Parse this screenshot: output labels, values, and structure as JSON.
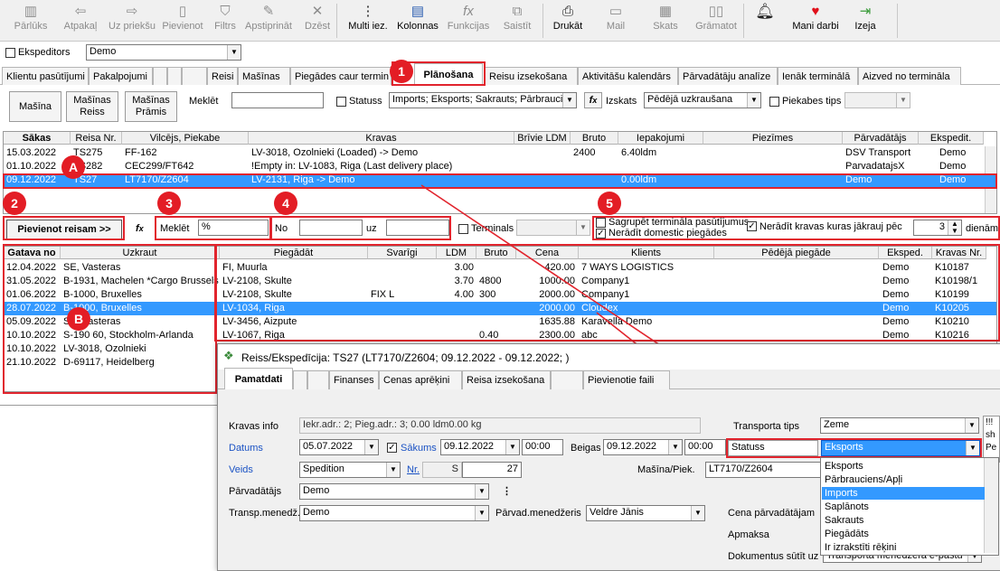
{
  "toolbar": {
    "items": [
      "Pārlūks",
      "Atpakaļ",
      "Uz priekšu",
      "Pievienot",
      "Filtrs",
      "Apstiprināt",
      "Dzēst",
      "Multi iez.",
      "Kolonnas",
      "Funkcijas",
      "Saistīt",
      "Drukāt",
      "Mail",
      "Skats",
      "Grāmatot",
      "",
      "Mani darbi",
      "Izeja"
    ]
  },
  "forwarder": {
    "label": "Ekspeditors",
    "value": "Demo"
  },
  "tabs": [
    "Klientu pasūtījumi",
    "Pakalpojumi",
    "",
    "",
    "",
    "Reisi",
    "Mašīnas",
    "Piegādes caur termin",
    "Plānošana",
    "Reisu izsekošana",
    "Aktivitāšu kalendārs",
    "Pārvadātāju analīze",
    "Ienāk terminālā",
    "Aizved no termināla"
  ],
  "top_controls": {
    "btn_masina": "Mašīna",
    "btn_masinas_reiss": "Mašīnas Reiss",
    "btn_masinas_pramis": "Mašīnas Prāmis",
    "search_label": "Meklēt",
    "status_label": "Statuss",
    "status_value": "Imports; Eksports; Sakrauts; Pārbraucie",
    "izskats_label": "Izskats",
    "izskats_value": "Pēdējā uzkraušana",
    "piekabes_label": "Piekabes tips"
  },
  "trips": {
    "headers": [
      "Sākas",
      "Reisa Nr.",
      "Vilcējs, Piekabe",
      "Kravas",
      "Brīvie LDM",
      "Bruto",
      "Iepakojumi",
      "Piezīmes",
      "Pārvadātājs",
      "Ekspedit."
    ],
    "rows": [
      [
        "15.03.2022",
        "TS275",
        "FF-162",
        "LV-3018, Ozolnieki (Loaded) -> Demo",
        "",
        "2400",
        "6.40ldm",
        "",
        "DSV Transport",
        "Demo"
      ],
      [
        "01.10.2022",
        "TS282",
        "CEC299/FT642",
        "!Empty in: LV-1083, Riga (Last delivery place)",
        "",
        "",
        "",
        "",
        "ParvadatajsX",
        "Demo"
      ],
      [
        "09.12.2022",
        "TS27",
        "LT7170/Z2604",
        "LV-2131, Riga -> Demo",
        "",
        "",
        "0.00ldm",
        "",
        "Demo",
        "Demo"
      ]
    ]
  },
  "mid_controls": {
    "add_btn": "Pievienot reisam >>",
    "search_label": "Meklēt",
    "search_value": "%",
    "no_label": "No",
    "uz_label": "uz",
    "terminals_label": "Terminals",
    "group_label": "Sagrupēt termināla pasūtījumus",
    "domestic_label": "Nerādīt domestic piegādes",
    "hide_label": "Nerādīt kravas kuras jākrauj pēc",
    "days_value": "3",
    "days_label": "dienām"
  },
  "orders": {
    "headers": [
      "Gatava no",
      "Uzkraut",
      "Piegādāt",
      "Svarīgi",
      "LDM",
      "Bruto",
      "Cena",
      "Klients",
      "Pēdējā piegāde",
      "Eksped.",
      "Kravas Nr."
    ],
    "rows": [
      [
        "12.04.2022",
        "SE, Vasteras",
        "FI, Muurla",
        "",
        "3.00",
        "",
        "420.00",
        "7 WAYS LOGISTICS",
        "",
        "Demo",
        "K10187"
      ],
      [
        "31.05.2022",
        "B-1931, Machelen *Cargo Brussels",
        "LV-2108, Skulte",
        "",
        "3.70",
        "4800",
        "1000.00",
        "Company1",
        "",
        "Demo",
        "K10198/1"
      ],
      [
        "01.06.2022",
        "B-1000, Bruxelles",
        "LV-2108, Skulte",
        "FIX L",
        "4.00",
        "300",
        "2000.00",
        "Company1",
        "",
        "Demo",
        "K10199"
      ],
      [
        "28.07.2022",
        "B-1000, Bruxelles",
        "LV-1034, Riga",
        "",
        "",
        "",
        "2000.00",
        "Cloudex",
        "",
        "Demo",
        "K10205"
      ],
      [
        "05.09.2022",
        "SE, Vasteras",
        "LV-3456, Aizpute",
        "",
        "",
        "",
        "1635.88",
        "Karavella Demo",
        "",
        "Demo",
        "K10210"
      ],
      [
        "10.10.2022",
        "S-190 60, Stockholm-Arlanda",
        "LV-1067, Riga",
        "",
        "",
        "0.40",
        "2300.00",
        "abc",
        "",
        "Demo",
        "K10216"
      ],
      [
        "10.10.2022",
        "LV-3018, Ozolnieki",
        "",
        "",
        "",
        "",
        "",
        "",
        "",
        "",
        ""
      ],
      [
        "21.10.2022",
        "D-69117, Heidelberg",
        "",
        "",
        "",
        "",
        "",
        "",
        "",
        "",
        ""
      ]
    ]
  },
  "annotations": {
    "badges": [
      "1",
      "2",
      "3",
      "4",
      "5",
      "A",
      "B"
    ]
  },
  "dialog": {
    "title": "Reiss/Ekspedīcija: TS27  (LT7170/Z2604; 09.12.2022 - 09.12.2022; )",
    "tabs": [
      "Pamatdati",
      "",
      "",
      "Finanses",
      "Cenas aprēķini",
      "Reisa izsekošana",
      "",
      "Pievienotie faili"
    ],
    "kravas_info_label": "Kravas info",
    "kravas_info_value": "Iekr.adr.: 2; Pieg.adr.: 3; 0.00 ldm0.00 kg",
    "datums_label": "Datums",
    "datums_value": "05.07.2022",
    "sakums_label": "Sākums",
    "sakums_date": "09.12.2022",
    "sakums_time": "00:00",
    "beigas_label": "Beigas",
    "beigas_date": "09.12.2022",
    "beigas_time": "00:00",
    "veids_label": "Veids",
    "veids_value": "Spedition",
    "nr_label": "Nr.",
    "nr_prefix": "S",
    "nr_value": "27",
    "parvadatajs_label": "Pārvadātājs",
    "parvadatajs_value": "Demo",
    "transp_label": "Transp.menedž.",
    "transp_value": "Demo",
    "parvad_men_label": "Pārvad.menedžeris",
    "parvad_men_value": "Veldre Jānis",
    "transporta_tips_label": "Transporta tips",
    "transporta_tips_value": "Zeme",
    "statuss_label": "Statuss",
    "statuss_value": "Eksports",
    "masina_label": "Mašīna/Piek.",
    "masina_value": "LT7170/Z2604",
    "cena_label": "Cena pārvadātājam",
    "apmaksa_label": "Apmaksa",
    "dokumentus_label": "Dokumentus sūtīt uz",
    "dokumentus_value": "Transporta menedžera e-pastu",
    "side_text": [
      "!!!",
      "sh",
      "Pe"
    ]
  },
  "status_options": [
    "Eksports",
    "Pārbrauciens/Apļi",
    "Imports",
    "Saplānots",
    "Sakrauts",
    "Piegādāts",
    "Ir izrakstīti rēķini"
  ],
  "status_selected": "Imports"
}
